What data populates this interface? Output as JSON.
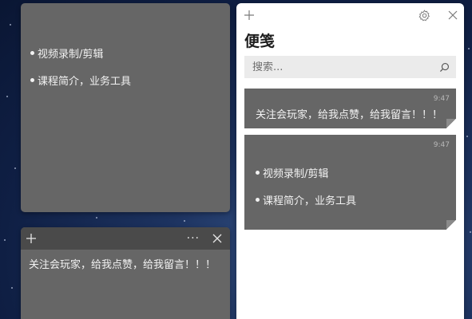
{
  "note1": {
    "items": [
      "视频录制/剪辑",
      "课程简介，业务工具"
    ]
  },
  "note2": {
    "text": "关注会玩家，给我点赞，给我留言！！！",
    "more_label": "···"
  },
  "panel": {
    "title": "便笺",
    "search_placeholder": "搜索...",
    "notes": [
      {
        "time": "9:47",
        "text": "关注会玩家，给我点赞，给我留言！！！"
      },
      {
        "time": "9:47",
        "items": [
          "视频录制/剪辑",
          "课程简介，业务工具"
        ]
      }
    ]
  },
  "colors": {
    "note_bg": "#666666",
    "note_header": "#4a4a4a",
    "panel_bg": "#ffffff",
    "search_bg": "#ebebeb",
    "desktop": "#0f1f44"
  }
}
